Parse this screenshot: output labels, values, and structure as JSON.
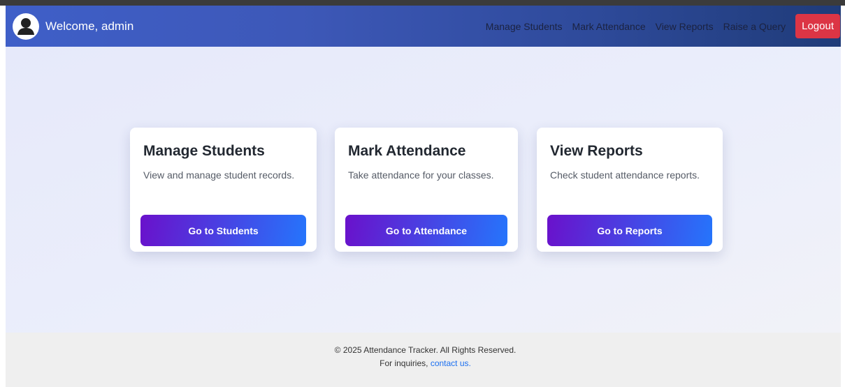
{
  "header": {
    "welcome": "Welcome, admin",
    "avatar_icon": "user-avatar-icon",
    "nav": [
      "Manage Students",
      "Mark Attendance",
      "View Reports",
      "Raise a Query"
    ],
    "logout": "Logout"
  },
  "cards": [
    {
      "title": "Manage Students",
      "desc": "View and manage student records.",
      "button": "Go to Students"
    },
    {
      "title": "Mark Attendance",
      "desc": "Take attendance for your classes.",
      "button": "Go to Attendance"
    },
    {
      "title": "View Reports",
      "desc": "Check student attendance reports.",
      "button": "Go to Reports"
    }
  ],
  "footer": {
    "copyright": "© 2025 Attendance Tracker. All Rights Reserved.",
    "inquiry_prefix": "For inquiries,",
    "contact_link": "contact us."
  },
  "colors": {
    "navbar": "#3d58b8",
    "logout": "#dc3545",
    "button_gradient_start": "#6a11cb",
    "button_gradient_end": "#2575fc",
    "link": "#1a6ff0"
  }
}
